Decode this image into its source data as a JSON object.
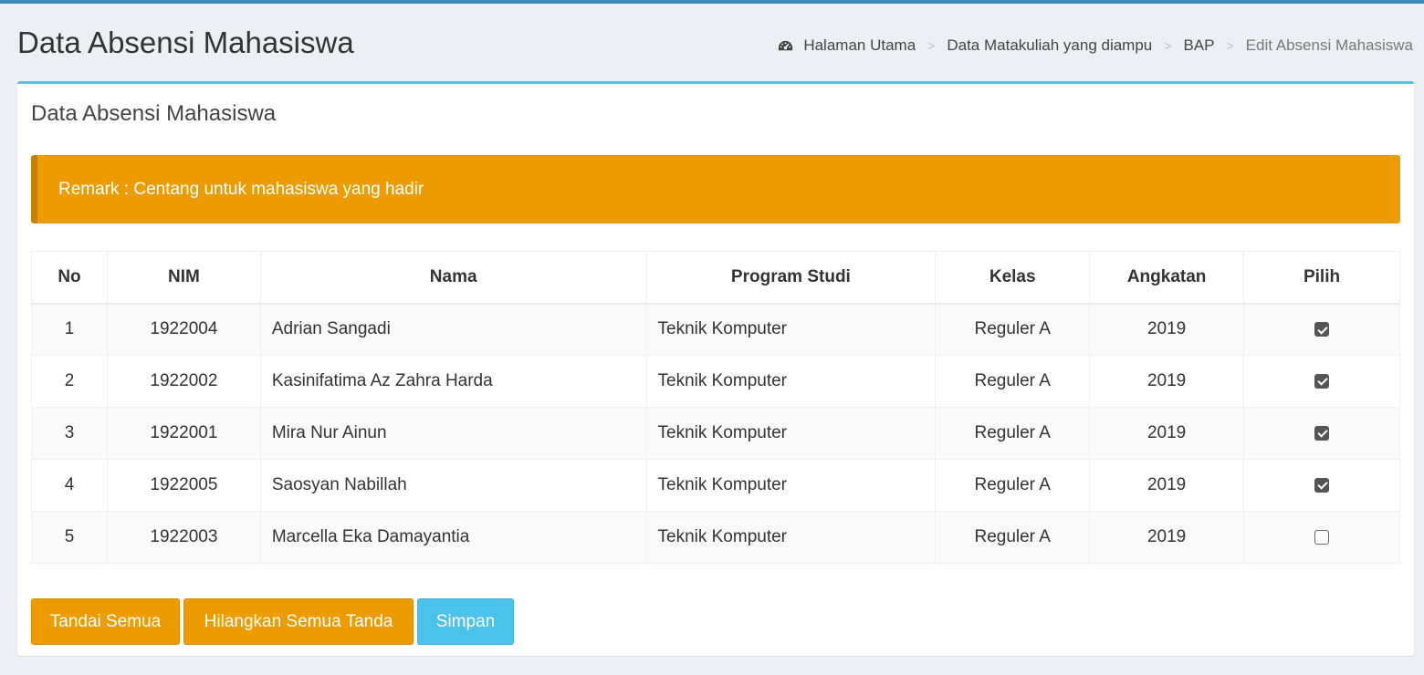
{
  "header": {
    "title": "Data Absensi Mahasiswa",
    "breadcrumb": [
      {
        "label": "Halaman Utama",
        "icon": "dashboard-icon"
      },
      {
        "label": "Data Matakuliah yang diampu"
      },
      {
        "label": "BAP"
      },
      {
        "label": "Edit Absensi Mahasiswa"
      }
    ],
    "separator": ">"
  },
  "box": {
    "title": "Data Absensi Mahasiswa",
    "remark": "Remark : Centang untuk mahasiswa yang hadir"
  },
  "table": {
    "columns": [
      "No",
      "NIM",
      "Nama",
      "Program Studi",
      "Kelas",
      "Angkatan",
      "Pilih"
    ],
    "rows": [
      {
        "no": "1",
        "nim": "1922004",
        "nama": "Adrian Sangadi",
        "prodi": "Teknik Komputer",
        "kelas": "Reguler A",
        "angkatan": "2019",
        "checked": true
      },
      {
        "no": "2",
        "nim": "1922002",
        "nama": "Kasinifatima Az Zahra Harda",
        "prodi": "Teknik Komputer",
        "kelas": "Reguler A",
        "angkatan": "2019",
        "checked": true
      },
      {
        "no": "3",
        "nim": "1922001",
        "nama": "Mira Nur Ainun",
        "prodi": "Teknik Komputer",
        "kelas": "Reguler A",
        "angkatan": "2019",
        "checked": true
      },
      {
        "no": "4",
        "nim": "1922005",
        "nama": "Saosyan Nabillah",
        "prodi": "Teknik Komputer",
        "kelas": "Reguler A",
        "angkatan": "2019",
        "checked": true
      },
      {
        "no": "5",
        "nim": "1922003",
        "nama": "Marcella Eka Damayantia",
        "prodi": "Teknik Komputer",
        "kelas": "Reguler A",
        "angkatan": "2019",
        "checked": false
      }
    ]
  },
  "buttons": {
    "mark_all": "Tandai Semua",
    "unmark_all": "Hilangkan Semua Tanda",
    "save": "Simpan"
  },
  "colors": {
    "accent": "#3c8dbc",
    "warning": "#ec9c00",
    "info": "#4bc2eb"
  }
}
